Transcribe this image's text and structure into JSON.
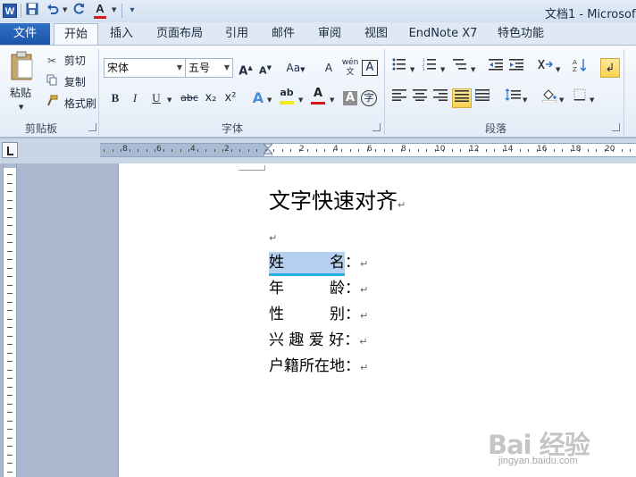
{
  "titlebar": {
    "app_icon": "W",
    "title": "文档1 - Microsof",
    "qat": [
      "save-icon",
      "undo-icon",
      "redo-icon",
      "font-color-icon",
      "customize-icon"
    ]
  },
  "tabs": {
    "file": "文件",
    "items": [
      "开始",
      "插入",
      "页面布局",
      "引用",
      "邮件",
      "审阅",
      "视图",
      "EndNote X7",
      "特色功能"
    ],
    "active": "开始"
  },
  "clipboard": {
    "paste": "粘贴",
    "cut": "剪切",
    "copy": "复制",
    "format_painter": "格式刷",
    "group": "剪贴板"
  },
  "font": {
    "name": "宋体",
    "size": "五号",
    "grow": "A",
    "shrink": "A",
    "change_case": "Aa",
    "clear": "A",
    "phonetic": "wén",
    "border_char": "A",
    "bold": "B",
    "italic": "I",
    "underline": "U",
    "strike": "abc",
    "sub": "x₂",
    "sup": "x²",
    "text_effect": "A",
    "highlight": "ab",
    "font_color": "A",
    "shading_char": "A",
    "enclose": "字",
    "group": "字体",
    "accent_red": "#d11a1a",
    "highlight_yellow": "#f2ea1d"
  },
  "paragraph": {
    "group": "段落"
  },
  "ruler": {
    "numbers": [
      "8",
      "6",
      "4",
      "2",
      "2",
      "4",
      "6",
      "8",
      "10",
      "12",
      "14",
      "16",
      "18",
      "20"
    ]
  },
  "document": {
    "title": "文字快速对齐",
    "lines": [
      {
        "pre": "",
        "sel": "姓　　　名",
        "post": "："
      },
      {
        "pre": "年　　　龄",
        "sel": "",
        "post": "："
      },
      {
        "pre": "性　　　别",
        "sel": "",
        "post": "："
      },
      {
        "pre": "兴 趣 爱 好",
        "sel": "",
        "post": "："
      },
      {
        "pre": "户籍所在地",
        "sel": "",
        "post": "："
      }
    ],
    "paragraph_mark": "↵"
  },
  "watermark": {
    "logo": "Bai 经验",
    "url": "jingyan.baidu.com"
  }
}
